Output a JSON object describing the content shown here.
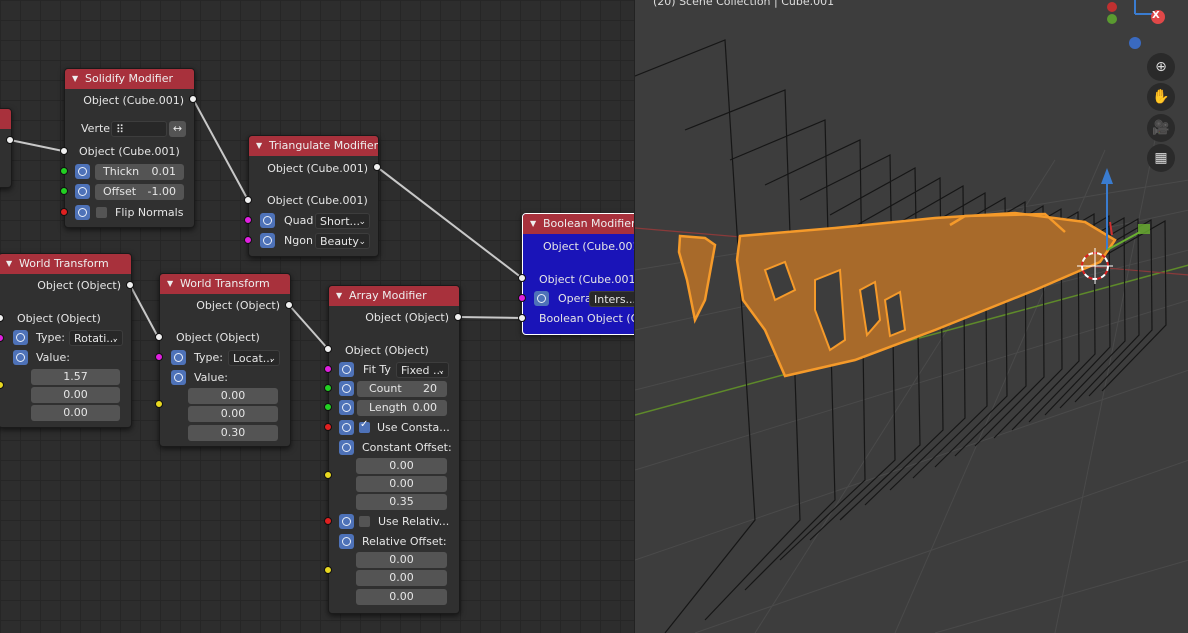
{
  "node_editor": {
    "nodes": {
      "solidify": {
        "title": "Solidify Modifier",
        "output_label": "Object (Cube.001)",
        "vertex_label": "Verte",
        "vertex_icon": "vertex-group-icon",
        "swap_icon": "swap-arrows-icon",
        "input_label": "Object (Cube.001)",
        "thickness": {
          "label": "Thickn",
          "value": "0.01"
        },
        "offset": {
          "label": "Offset",
          "value": "-1.00"
        },
        "flip_normals_label": "Flip Normals",
        "flip_normals_checked": false
      },
      "triangulate": {
        "title": "Triangulate Modifier",
        "output_label": "Object (Cube.001)",
        "input_label": "Object (Cube.001)",
        "quad_label": "Quad",
        "quad_value": "Short...",
        "ngon_label": "Ngon",
        "ngon_value": "Beauty"
      },
      "boolean": {
        "title": "Boolean Modifier",
        "output_label": "Object (Cube.001",
        "input_label": "Object (Cube.001)",
        "operation_label": "Opera",
        "operation_value": "Inters...",
        "boolean_object_label": "Boolean Object (O"
      },
      "world1": {
        "title": "World Transform",
        "output_label": "Object (Object)",
        "input_label": "Object (Object)",
        "type_label": "Type:",
        "type_value": "Rotati...",
        "value_label": "Value:",
        "values": [
          "1.57",
          "0.00",
          "0.00"
        ]
      },
      "world2": {
        "title": "World Transform",
        "output_label": "Object (Object)",
        "input_label": "Object (Object)",
        "type_label": "Type:",
        "type_value": "Locat...",
        "value_label": "Value:",
        "values": [
          "0.00",
          "0.00",
          "0.30"
        ]
      },
      "array": {
        "title": "Array Modifier",
        "output_label": "Object (Object)",
        "input_label": "Object (Object)",
        "fit_type_label": "Fit Ty",
        "fit_type_value": "Fixed ...",
        "count": {
          "label": "Count",
          "value": "20"
        },
        "length": {
          "label": "Length",
          "value": "0.00"
        },
        "use_constant_label": "Use Consta...",
        "use_constant_checked": true,
        "constant_offset_label": "Constant Offset:",
        "constant_offset": [
          "0.00",
          "0.00",
          "0.35"
        ],
        "use_relative_label": "Use Relativ...",
        "use_relative_checked": false,
        "relative_offset_label": "Relative Offset:",
        "relative_offset": [
          "0.00",
          "0.00",
          "0.00"
        ]
      }
    }
  },
  "viewport": {
    "header_text": "(20) Scene Collection | Cube.001",
    "nav_buttons": [
      {
        "name": "zoom-icon",
        "glyph": "⊕"
      },
      {
        "name": "hand-pan-icon",
        "glyph": "✋"
      },
      {
        "name": "camera-icon",
        "glyph": "🎥"
      },
      {
        "name": "grid-perspective-icon",
        "glyph": "▦"
      }
    ],
    "gizmo_axis_label": "X",
    "colors": {
      "background": "#3d3d3d",
      "selection_outline": "#f59a2a",
      "selection_fill": "#a86a2a",
      "node_header": "#a8313c",
      "active_node": "#1a14b8"
    }
  }
}
